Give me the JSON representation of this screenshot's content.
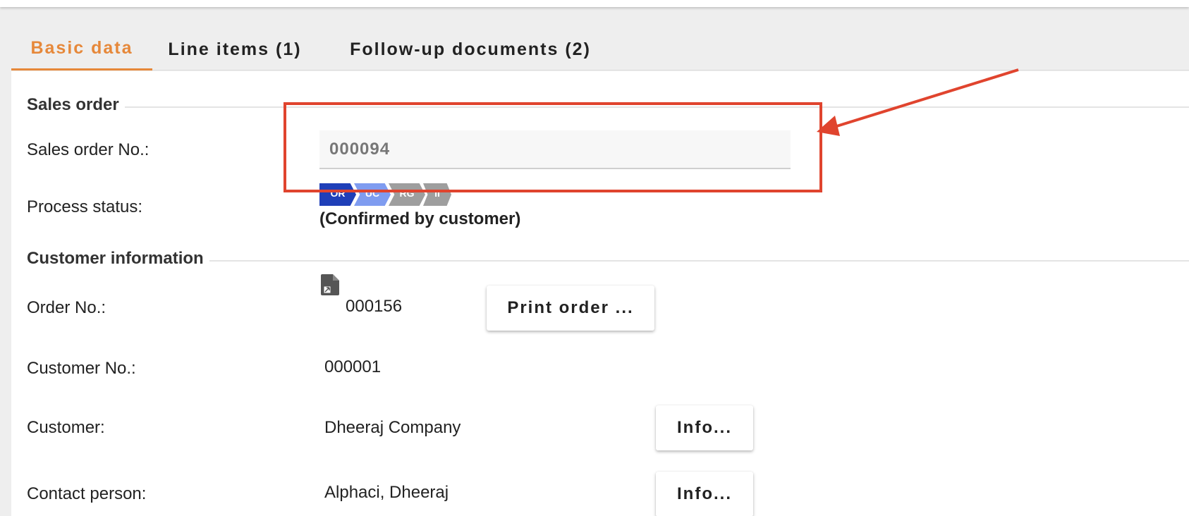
{
  "tabs": [
    {
      "label": "Basic data",
      "active": true
    },
    {
      "label": "Line items (1)",
      "active": false
    },
    {
      "label": "Follow-up documents (2)",
      "active": false
    }
  ],
  "sales_order": {
    "section_title": "Sales order",
    "number_label": "Sales order No.:",
    "number_value": "000094",
    "status_label": "Process status:",
    "status_steps": [
      {
        "label": "OR",
        "color": "#1f3fb8"
      },
      {
        "label": "UC",
        "color": "#7f9cf0"
      },
      {
        "label": "RG",
        "color": "#9e9e9e"
      },
      {
        "label": "II",
        "color": "#9e9e9e"
      }
    ],
    "status_text": "(Confirmed by customer)"
  },
  "customer_info": {
    "section_title": "Customer information",
    "order_label": "Order No.:",
    "order_value": "000156",
    "order_icon": "document-icon",
    "print_button": "Print order ...",
    "customer_no_label": "Customer No.:",
    "customer_no_value": "000001",
    "customer_label": "Customer:",
    "customer_value": "Dheeraj Company",
    "customer_info_button": "Info...",
    "contact_label": "Contact person:",
    "contact_value": "Alphaci, Dheeraj",
    "contact_info_button": "Info..."
  },
  "colors": {
    "accent": "#e6883a",
    "annotation": "#e0442e"
  }
}
